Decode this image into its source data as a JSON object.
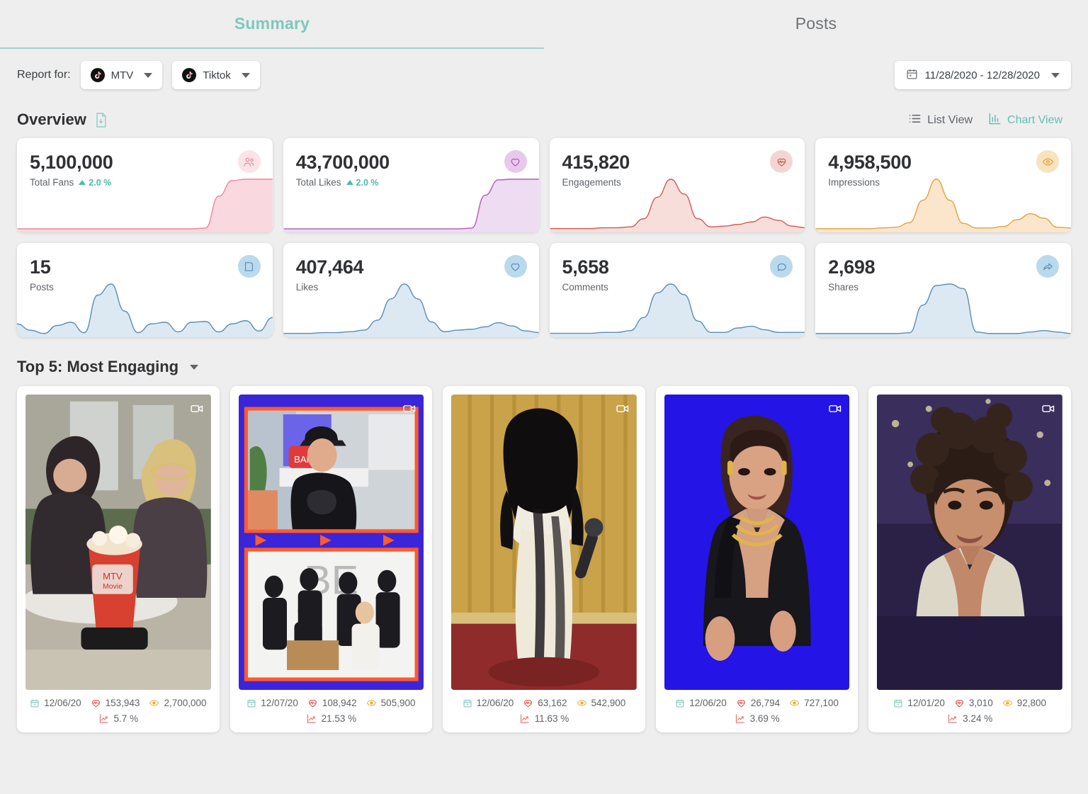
{
  "tabs": [
    {
      "label": "Summary",
      "active": true
    },
    {
      "label": "Posts",
      "active": false
    }
  ],
  "report_bar": {
    "label": "Report for:",
    "selectors": [
      {
        "label": "MTV",
        "icon": "tiktok-icon"
      },
      {
        "label": "Tiktok",
        "icon": "tiktok-icon"
      }
    ],
    "date_range": {
      "value": "11/28/2020 - 12/28/2020",
      "icon": "calendar-icon"
    }
  },
  "overview": {
    "title": "Overview",
    "download_icon": "document-download-icon",
    "views": [
      {
        "label": "List View",
        "icon": "list-icon",
        "active": false
      },
      {
        "label": "Chart View",
        "icon": "bar-chart-icon",
        "active": true
      }
    ]
  },
  "colors": {
    "teal": "#7ec8bd",
    "teal_active": "#62bfb1",
    "pink": "#e8899f",
    "purple": "#b47cc7",
    "red": "#d9534f",
    "orange": "#e8a33d",
    "blue": "#6b9ec4",
    "page_bg": "#eeeeee"
  },
  "kpis": [
    {
      "value": "5,100,000",
      "label": "Total Fans",
      "delta": "2.0 %",
      "delta_dir": "up",
      "icon": "users-icon",
      "color": "#e8899f",
      "icon_bg": "#fbe3e8",
      "fill": "#f9d8e0"
    },
    {
      "value": "43,700,000",
      "label": "Total Likes",
      "delta": "2.0 %",
      "delta_dir": "up",
      "icon": "heart-icon",
      "color": "#b558b8",
      "icon_bg": "#e7c9ec",
      "fill": "#eddcf2"
    },
    {
      "value": "415,820",
      "label": "Engagements",
      "delta": null,
      "delta_dir": null,
      "icon": "heart-pulse-icon",
      "color": "#cf5b52",
      "icon_bg": "#f3d6d2",
      "fill": "#f7dedb"
    },
    {
      "value": "4,958,500",
      "label": "Impressions",
      "delta": null,
      "delta_dir": null,
      "icon": "eye-icon",
      "color": "#e2a23f",
      "icon_bg": "#f7e3bd",
      "fill": "#fbe6cc"
    },
    {
      "value": "15",
      "label": "Posts",
      "delta": null,
      "delta_dir": null,
      "icon": "post-icon",
      "color": "#5b8db5",
      "icon_bg": "#b9d9ed",
      "fill": "#dce9f3"
    },
    {
      "value": "407,464",
      "label": "Likes",
      "delta": null,
      "delta_dir": null,
      "icon": "heart-outline-icon",
      "color": "#5b8db5",
      "icon_bg": "#b9d9ed",
      "fill": "#dce9f3"
    },
    {
      "value": "5,658",
      "label": "Comments",
      "delta": null,
      "delta_dir": null,
      "icon": "comment-icon",
      "color": "#5b8db5",
      "icon_bg": "#b9d9ed",
      "fill": "#dce9f3"
    },
    {
      "value": "2,698",
      "label": "Shares",
      "delta": null,
      "delta_dir": null,
      "icon": "share-icon",
      "color": "#5b8db5",
      "icon_bg": "#b9d9ed",
      "fill": "#dce9f3"
    }
  ],
  "chart_data": [
    {
      "type": "area",
      "title": "Total Fans",
      "ylabel": "Fans",
      "x": [
        0,
        1,
        2,
        3,
        4,
        5,
        6,
        7,
        8,
        9,
        10,
        11,
        12,
        13,
        14,
        15,
        16,
        17,
        18,
        19
      ],
      "values": [
        2,
        2,
        2,
        2,
        2,
        2,
        2,
        2,
        2,
        2,
        2,
        2,
        2,
        2,
        3,
        48,
        70,
        72,
        72,
        72
      ]
    },
    {
      "type": "area",
      "title": "Total Likes",
      "ylabel": "Likes",
      "x": [
        0,
        1,
        2,
        3,
        4,
        5,
        6,
        7,
        8,
        9,
        10,
        11,
        12,
        13,
        14,
        15,
        16,
        17,
        18,
        19
      ],
      "values": [
        2,
        2,
        2,
        2,
        2,
        2,
        2,
        2,
        2,
        2,
        2,
        2,
        2,
        2,
        3,
        50,
        72,
        73,
        73,
        73
      ]
    },
    {
      "type": "area",
      "title": "Engagements",
      "ylabel": "Engagements",
      "x": [
        0,
        1,
        2,
        3,
        4,
        5,
        6,
        7,
        8,
        9,
        10,
        11,
        12,
        13,
        14,
        15,
        16,
        17,
        18,
        19
      ],
      "values": [
        2,
        2,
        2,
        2,
        3,
        3,
        4,
        14,
        40,
        62,
        44,
        14,
        4,
        5,
        7,
        10,
        16,
        12,
        5,
        3
      ]
    },
    {
      "type": "area",
      "title": "Impressions",
      "ylabel": "Impressions",
      "x": [
        0,
        1,
        2,
        3,
        4,
        5,
        6,
        7,
        8,
        9,
        10,
        11,
        12,
        13,
        14,
        15,
        16,
        17,
        18,
        19
      ],
      "values": [
        2,
        2,
        2,
        2,
        2,
        3,
        4,
        10,
        40,
        68,
        40,
        9,
        3,
        3,
        5,
        14,
        22,
        16,
        4,
        3
      ]
    },
    {
      "type": "area",
      "title": "Posts",
      "ylabel": "Posts",
      "x": [
        0,
        1,
        2,
        3,
        4,
        5,
        6,
        7,
        8,
        9,
        10,
        11,
        12,
        13,
        14,
        15,
        16,
        17,
        18,
        19
      ],
      "values": [
        14,
        6,
        2,
        12,
        16,
        3,
        50,
        64,
        30,
        3,
        14,
        16,
        4,
        16,
        17,
        4,
        14,
        18,
        5,
        22
      ]
    },
    {
      "type": "area",
      "title": "Likes",
      "ylabel": "Likes",
      "x": [
        0,
        1,
        2,
        3,
        4,
        5,
        6,
        7,
        8,
        9,
        10,
        11,
        12,
        13,
        14,
        15,
        16,
        17,
        18,
        19
      ],
      "values": [
        2,
        2,
        2,
        3,
        3,
        4,
        6,
        18,
        44,
        62,
        44,
        16,
        4,
        6,
        7,
        10,
        15,
        11,
        5,
        3
      ]
    },
    {
      "type": "area",
      "title": "Comments",
      "ylabel": "Comments",
      "x": [
        0,
        1,
        2,
        3,
        4,
        5,
        6,
        7,
        8,
        9,
        10,
        11,
        12,
        13,
        14,
        15,
        16,
        17,
        18,
        19
      ],
      "values": [
        2,
        2,
        2,
        2,
        3,
        3,
        5,
        20,
        48,
        58,
        46,
        16,
        3,
        3,
        8,
        10,
        6,
        3,
        3,
        3
      ]
    },
    {
      "type": "area",
      "title": "Shares",
      "ylabel": "Shares",
      "x": [
        0,
        1,
        2,
        3,
        4,
        5,
        6,
        7,
        8,
        9,
        10,
        11,
        12,
        13,
        14,
        15,
        16,
        17,
        18,
        19
      ],
      "values": [
        2,
        2,
        2,
        2,
        2,
        2,
        2,
        3,
        40,
        66,
        68,
        62,
        4,
        2,
        2,
        2,
        4,
        6,
        4,
        2
      ]
    }
  ],
  "top5": {
    "title": "Top 5: Most Engaging",
    "dropdown_icon": "chevron-down-icon"
  },
  "posts": [
    {
      "date": "12/06/20",
      "engagements": "153,943",
      "impressions": "2,700,000",
      "rate": "5.7 %",
      "media_type": "video",
      "thumb": "two-women-popcorn"
    },
    {
      "date": "12/07/20",
      "engagements": "108,942",
      "impressions": "505,900",
      "rate": "21.53 %",
      "media_type": "video",
      "thumb": "split-interview-be"
    },
    {
      "date": "12/06/20",
      "engagements": "63,162",
      "impressions": "542,900",
      "rate": "11.63 %",
      "media_type": "video",
      "thumb": "slime-performer"
    },
    {
      "date": "12/06/20",
      "engagements": "26,794",
      "impressions": "727,100",
      "rate": "3.69 %",
      "media_type": "video",
      "thumb": "host-blue-bg"
    },
    {
      "date": "12/01/20",
      "engagements": "3,010",
      "impressions": "92,800",
      "rate": "3.24 %",
      "media_type": "video",
      "thumb": "curly-hair-teen"
    }
  ]
}
